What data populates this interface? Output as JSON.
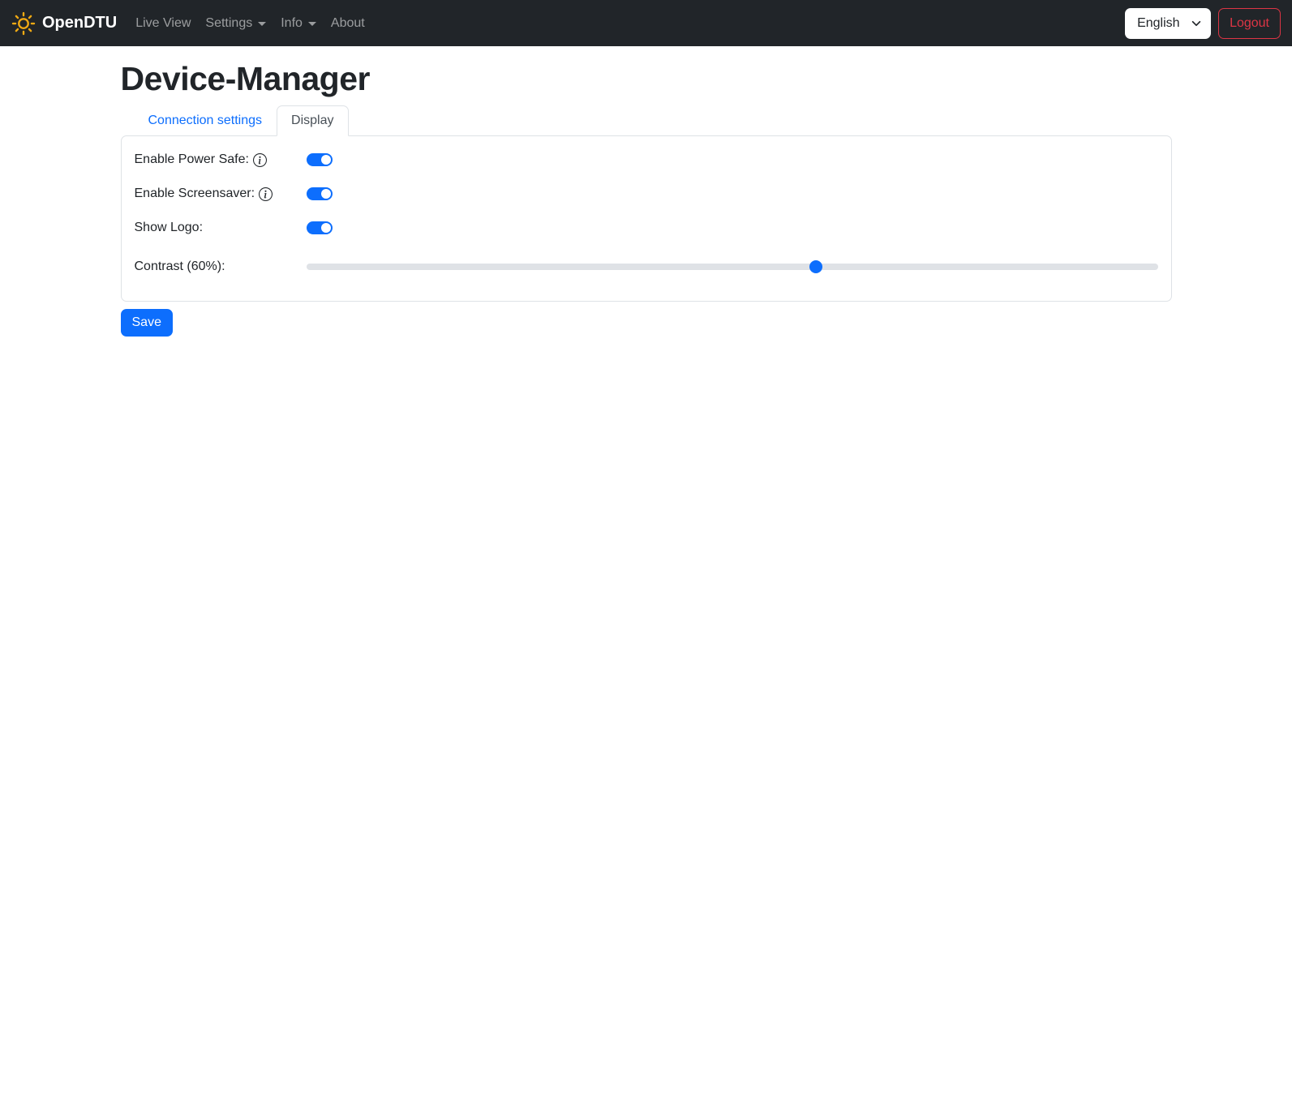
{
  "navbar": {
    "brand": "OpenDTU",
    "items": [
      {
        "label": "Live View",
        "has_dropdown": false
      },
      {
        "label": "Settings",
        "has_dropdown": true
      },
      {
        "label": "Info",
        "has_dropdown": true
      },
      {
        "label": "About",
        "has_dropdown": false
      }
    ],
    "language_selected": "English",
    "logout_label": "Logout"
  },
  "page": {
    "title": "Device-Manager"
  },
  "tabs": [
    {
      "label": "Connection settings",
      "active": false
    },
    {
      "label": "Display",
      "active": true
    }
  ],
  "display_form": {
    "fields": [
      {
        "label": "Enable Power Safe:",
        "has_info_icon": true,
        "type": "switch",
        "enabled": true
      },
      {
        "label": "Enable Screensaver:",
        "has_info_icon": true,
        "type": "switch",
        "enabled": true
      },
      {
        "label": "Show Logo:",
        "has_info_icon": false,
        "type": "switch",
        "enabled": true
      },
      {
        "label": "Contrast (60%):",
        "has_info_icon": false,
        "type": "range",
        "value": 60
      }
    ],
    "save_label": "Save"
  },
  "colors": {
    "primary": "#0d6efd",
    "danger": "#dc3545",
    "navbar_bg": "#212529",
    "sun_icon": "#f0a913",
    "card_border": "#dee2e6",
    "slider_track": "#dfe2e6",
    "tab_active_text": "#495057"
  }
}
